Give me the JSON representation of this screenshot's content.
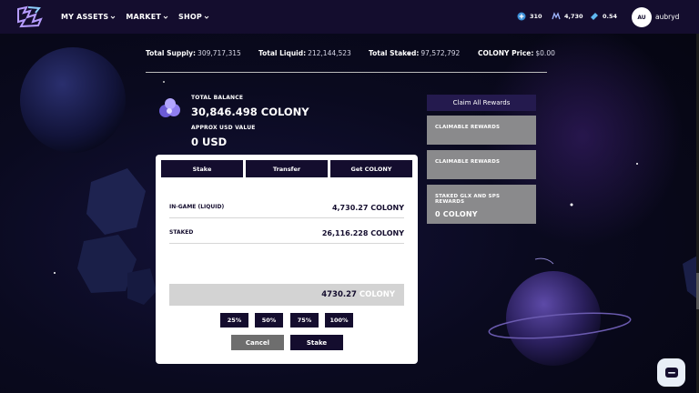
{
  "nav": {
    "items": [
      {
        "label": "MY ASSETS"
      },
      {
        "label": "MARKET"
      },
      {
        "label": "SHOP"
      }
    ],
    "stats": [
      {
        "icon": "plus-badge-icon",
        "value": "310"
      },
      {
        "icon": "credits-icon",
        "value": "4,730"
      },
      {
        "icon": "ticket-icon",
        "value": "0.54"
      }
    ],
    "user": {
      "initials": "AU",
      "name": "aubryd"
    }
  },
  "supply": [
    {
      "label": "Total Supply:",
      "value": "309,717,315"
    },
    {
      "label": "Total Liquid:",
      "value": "212,144,523"
    },
    {
      "label": "Total Staked:",
      "value": "97,572,792"
    },
    {
      "label": "COLONY Price:",
      "value": "$0.00"
    }
  ],
  "balance": {
    "total_label": "TOTAL BALANCE",
    "total_value": "30,846.498 COLONY",
    "usd_label": "APPROX USD VALUE",
    "usd_value": "0 USD"
  },
  "rewards": {
    "claim_all": "Claim All Rewards",
    "boxes": [
      {
        "label": "CLAIMABLE REWARDS",
        "value": ""
      },
      {
        "label": "CLAIMABLE REWARDS",
        "value": ""
      },
      {
        "label": "STAKED GLX AND SPS REWARDS",
        "value": "0 COLONY"
      }
    ]
  },
  "panel": {
    "tabs": [
      "Stake",
      "Transfer",
      "Get COLONY"
    ],
    "rows": [
      {
        "label": "IN-GAME (LIQUID)",
        "value": "4,730.27 COLONY"
      },
      {
        "label": "STAKED",
        "value": "26,116.228 COLONY"
      }
    ],
    "amount": "4730.27",
    "amount_unit": "COLONY",
    "percents": [
      "25%",
      "50%",
      "75%",
      "100%"
    ],
    "cancel": "Cancel",
    "submit": "Stake"
  },
  "colors": {
    "topbar": "#140d2e",
    "button": "#140d2e",
    "reward_box": "#8a8a8c",
    "cancel": "#6e6e6e"
  }
}
